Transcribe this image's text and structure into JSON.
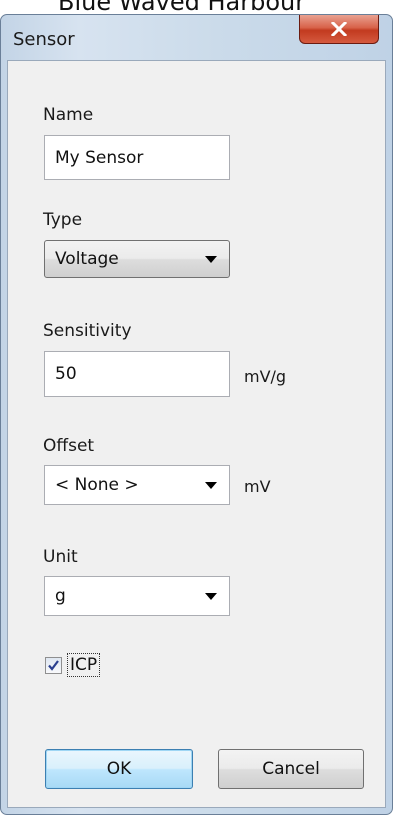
{
  "window": {
    "background_caption": "Blue Waved Harbour",
    "title": "Sensor",
    "close_glyph": "X"
  },
  "form": {
    "name": {
      "label": "Name",
      "value": "My Sensor"
    },
    "type": {
      "label": "Type",
      "selected": "Voltage"
    },
    "sensitivity": {
      "label": "Sensitivity",
      "value": "50",
      "unit": "mV/g"
    },
    "offset": {
      "label": "Offset",
      "selected": "< None >",
      "unit": "mV"
    },
    "unit": {
      "label": "Unit",
      "selected": "g"
    },
    "icp": {
      "label": "ICP",
      "checked": true
    }
  },
  "buttons": {
    "ok_label": "OK",
    "cancel_label": "Cancel"
  },
  "colors": {
    "close_button": "#c7452a",
    "default_button_border": "#3c7fb1",
    "dialog_face": "#f0f0f0"
  }
}
